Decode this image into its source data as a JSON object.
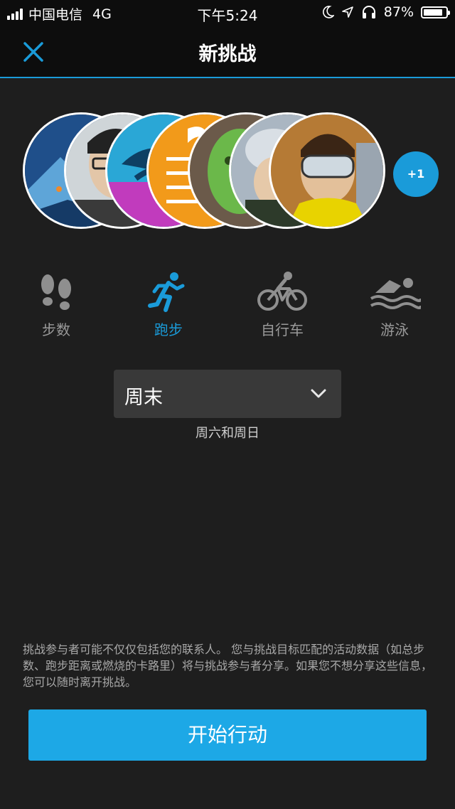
{
  "status_bar": {
    "carrier": "中国电信",
    "network": "4G",
    "time": "下午5:24",
    "battery": "87%",
    "battery_level": 0.87
  },
  "nav": {
    "title": "新挑战",
    "close_icon": "close-icon"
  },
  "participants": {
    "extra_count": "+1",
    "avatars": [
      {
        "desc": "landscape",
        "colors": [
          "#1f4f8a",
          "#5ea5d8"
        ]
      },
      {
        "desc": "man-glasses",
        "colors": [
          "#cfd5d8",
          "#3a3a3a"
        ]
      },
      {
        "desc": "wave-logo",
        "colors": [
          "#2aa7d6",
          "#c13bbd"
        ]
      },
      {
        "desc": "orange-doc",
        "colors": [
          "#f29a1a",
          "#ffffff"
        ]
      },
      {
        "desc": "green-figure",
        "colors": [
          "#6bb84a",
          "#6b5a4a"
        ]
      },
      {
        "desc": "cyclist",
        "colors": [
          "#d9dfe5",
          "#aab6c2"
        ]
      },
      {
        "desc": "skier-goggles",
        "colors": [
          "#e6a73a",
          "#e8d300"
        ]
      }
    ]
  },
  "activities": [
    {
      "label": "步数",
      "icon": "footprints-icon",
      "active": false
    },
    {
      "label": "跑步",
      "icon": "running-icon",
      "active": true
    },
    {
      "label": "自行车",
      "icon": "bicycle-icon",
      "active": false
    },
    {
      "label": "游泳",
      "icon": "swimming-icon",
      "active": false
    }
  ],
  "period": {
    "selected": "周末",
    "subtitle": "周六和周日"
  },
  "disclaimer": "挑战参与者可能不仅仅包括您的联系人。 您与挑战目标匹配的活动数据（如总步数、跑步距离或燃烧的卡路里）将与挑战参与者分享。如果您不想分享这些信息，您可以随时离开挑战。",
  "cta_label": "开始行动",
  "colors": {
    "accent": "#1a9bd9",
    "button": "#1da8e6",
    "background": "#1e1e1e",
    "bar": "#0d0d0d"
  }
}
